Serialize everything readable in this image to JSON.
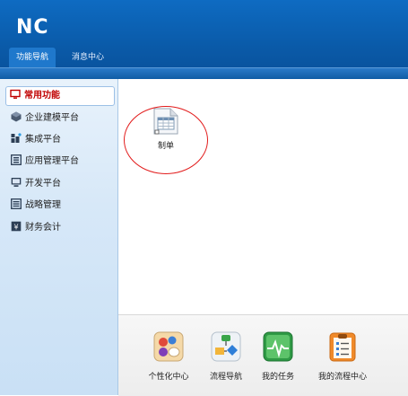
{
  "header": {
    "logo": "NC"
  },
  "tabs": {
    "items": [
      {
        "label": "功能导航"
      },
      {
        "label": "消息中心"
      }
    ]
  },
  "sidebar": {
    "items": [
      {
        "label": "常用功能",
        "icon": "monitor-icon",
        "active": true
      },
      {
        "label": "企业建模平台",
        "icon": "cube-icon"
      },
      {
        "label": "集成平台",
        "icon": "blocks-icon"
      },
      {
        "label": "应用管理平台",
        "icon": "app-icon"
      },
      {
        "label": "开发平台",
        "icon": "monitor-icon"
      },
      {
        "label": "战略管理",
        "icon": "list-icon"
      },
      {
        "label": "财务会计",
        "icon": "ledger-icon"
      }
    ]
  },
  "main": {
    "workarea_item": {
      "label": "制单",
      "icon": "voucher-icon"
    }
  },
  "bottom": {
    "items": [
      {
        "label": "个性化中心",
        "icon": "palette-icon"
      },
      {
        "label": "流程导航",
        "icon": "flowchart-icon"
      },
      {
        "label": "我的任务",
        "icon": "pulse-icon"
      },
      {
        "label": "我的流程中心",
        "icon": "clipboard-icon"
      }
    ]
  }
}
